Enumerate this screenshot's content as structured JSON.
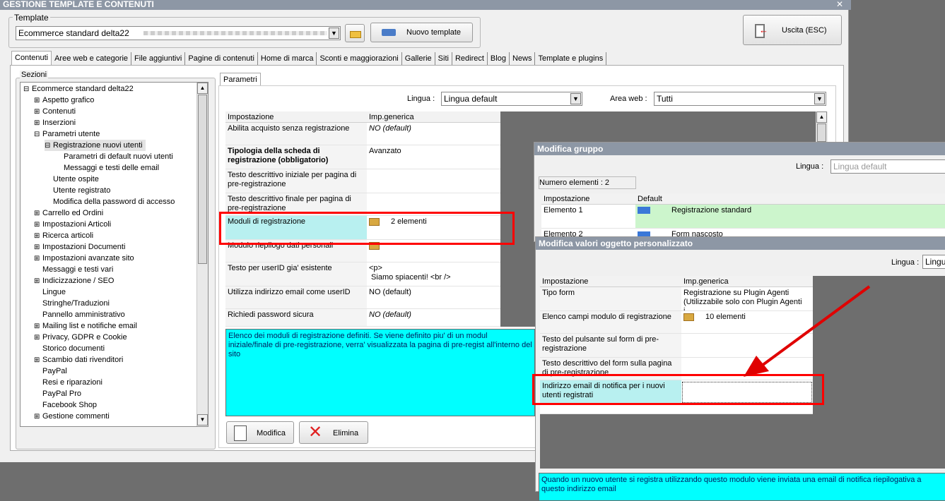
{
  "window_title": "GESTIONE TEMPLATE E CONTENUTI",
  "template": {
    "group_label": "Template",
    "selected": "Ecommerce standard delta22",
    "new_button": "Nuovo template",
    "exit_button": "Uscita (ESC)"
  },
  "tabs": [
    "Contenuti",
    "Aree web e categorie",
    "File aggiuntivi",
    "Pagine di contenuti",
    "Home di marca",
    "Sconti e maggiorazioni",
    "Gallerie",
    "Siti",
    "Redirect",
    "Blog",
    "News",
    "Template e plugins"
  ],
  "sections": {
    "label": "Sezioni",
    "items": [
      {
        "pm": "⊟",
        "label": "Ecommerce standard delta22"
      },
      {
        "pm": "⊞",
        "label": "Aspetto grafico"
      },
      {
        "pm": "⊞",
        "label": "Contenuti"
      },
      {
        "pm": "⊞",
        "label": "Inserzioni"
      },
      {
        "pm": "⊟",
        "label": "Parametri utente"
      },
      {
        "pm": "⊟",
        "label": "Registrazione nuovi utenti"
      },
      {
        "pm": "",
        "label": "Parametri di default nuovi utenti"
      },
      {
        "pm": "",
        "label": "Messaggi e testi delle email"
      },
      {
        "pm": "",
        "label": "Utente ospite"
      },
      {
        "pm": "",
        "label": "Utente registrato"
      },
      {
        "pm": "",
        "label": "Modifica della password di accesso"
      },
      {
        "pm": "⊞",
        "label": "Carrello ed Ordini"
      },
      {
        "pm": "⊞",
        "label": "Impostazioni Articoli"
      },
      {
        "pm": "⊞",
        "label": "Ricerca articoli"
      },
      {
        "pm": "⊞",
        "label": "Impostazioni Documenti"
      },
      {
        "pm": "⊞",
        "label": "Impostazioni avanzate sito"
      },
      {
        "pm": "",
        "label": "Messaggi e testi vari"
      },
      {
        "pm": "⊞",
        "label": "Indicizzazione / SEO"
      },
      {
        "pm": "",
        "label": "Lingue"
      },
      {
        "pm": "",
        "label": "Stringhe/Traduzioni"
      },
      {
        "pm": "",
        "label": "Pannello amministrativo"
      },
      {
        "pm": "⊞",
        "label": "Mailing list e notifiche email"
      },
      {
        "pm": "⊞",
        "label": "Privacy, GDPR e Cookie"
      },
      {
        "pm": "",
        "label": "Storico documenti"
      },
      {
        "pm": "⊞",
        "label": "Scambio dati rivenditori"
      },
      {
        "pm": "",
        "label": "PayPal"
      },
      {
        "pm": "",
        "label": "Resi e riparazioni"
      },
      {
        "pm": "",
        "label": "PayPal Pro"
      },
      {
        "pm": "",
        "label": "Facebook Shop"
      },
      {
        "pm": "⊞",
        "label": "Gestione commenti"
      }
    ]
  },
  "params": {
    "tab": "Parametri",
    "lingua_label": "Lingua :",
    "lingua_value": "Lingua default",
    "area_label": "Area web :",
    "area_value": "Tutti",
    "col1": "Impostazione",
    "col2": "Imp.generica",
    "rows": [
      {
        "name": "Abilita acquisto senza registrazione",
        "value": "NO (default)"
      },
      {
        "name": "Tipologia della scheda di registrazione (obbligatorio)",
        "value": "Avanzato"
      },
      {
        "name": "Testo descrittivo iniziale per pagina di pre-registrazione",
        "value": ""
      },
      {
        "name": "Testo descrittivo finale per pagina di pre-registrazione",
        "value": ""
      },
      {
        "name": "Moduli di registrazione",
        "value": "2 elementi"
      },
      {
        "name": "Modulo riepilogo dati personali",
        "value": ""
      },
      {
        "name": "Testo per userID gia' esistente",
        "value": "<p>\n Siamo spiacenti! <br />"
      },
      {
        "name": "Utilizza indirizzo email come userID",
        "value": "NO (default)"
      },
      {
        "name": "Richiedi password sicura",
        "value": "NO (default)"
      }
    ],
    "description": "Elenco dei moduli di registrazione definiti. Se viene definito piu' di un modul iniziale/finale di pre-registrazione, verra' visualizzata la pagina di pre-regist all'interno del sito",
    "modify_button": "Modifica",
    "delete_button": "Elimina"
  },
  "group_dialog": {
    "title": "Modifica gruppo",
    "lingua_label": "Lingua :",
    "lingua_value": "Lingua default",
    "count": "Numero elementi : 2",
    "col1": "Impostazione",
    "col2": "Default",
    "rows": [
      {
        "name": "Elemento 1",
        "value": "Registrazione standard"
      },
      {
        "name": "Elemento 2",
        "value": "Form nascosto"
      }
    ]
  },
  "object_dialog": {
    "title": "Modifica valori oggetto personalizzato",
    "lingua_label": "Lingua :",
    "lingua_value": "Lingu",
    "col1": "Impostazione",
    "col2": "Imp.generica",
    "rows": [
      {
        "name": "Tipo form",
        "value": "Registrazione su Plugin Agenti (Utilizzabile solo con Plugin Agenti i..."
      },
      {
        "name": "Elenco campi modulo di registrazione",
        "value": "10 elementi"
      },
      {
        "name": "Testo del pulsante sul form di pre-registrazione",
        "value": ""
      },
      {
        "name": "Testo descrittivo del form sulla pagina di pre-registrazione",
        "value": ""
      },
      {
        "name": "Indirizzo email di notifica per i nuovi utenti registrati",
        "value": ""
      }
    ],
    "description": "Quando un nuovo utente si registra utilizzando questo modulo viene inviata una email di notifica riepilogativa a questo indirizzo email"
  }
}
